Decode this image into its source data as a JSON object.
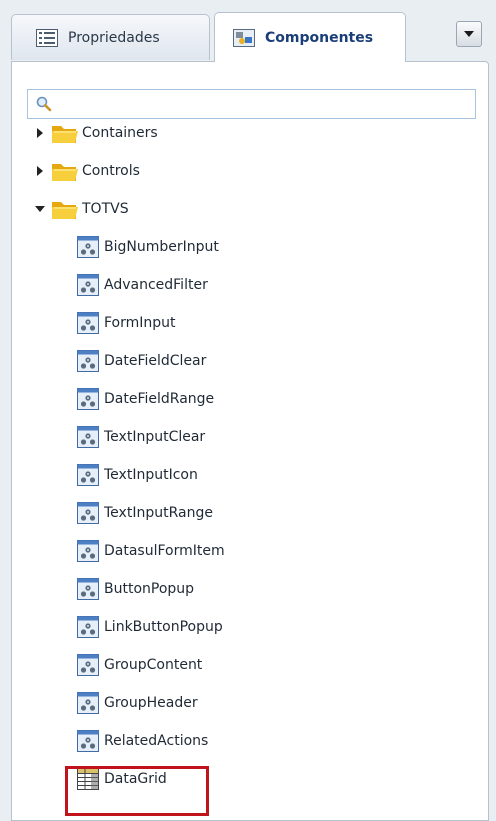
{
  "tabs": {
    "properties": "Propriedades",
    "components": "Componentes"
  },
  "search": {
    "value": "",
    "placeholder": ""
  },
  "tree": {
    "folders": [
      {
        "label": "Containers",
        "expanded": false
      },
      {
        "label": "Controls",
        "expanded": false
      },
      {
        "label": "TOTVS",
        "expanded": true
      }
    ],
    "components": [
      "BigNumberInput",
      "AdvancedFilter",
      "FormInput",
      "DateFieldClear",
      "DateFieldRange",
      "TextInputClear",
      "TextInputIcon",
      "TextInputRange",
      "DatasulFormItem",
      "ButtonPopup",
      "LinkButtonPopup",
      "GroupContent",
      "GroupHeader",
      "RelatedActions",
      "DataGrid"
    ],
    "highlighted": "DataGrid"
  },
  "colors": {
    "accent": "#1a3e78",
    "highlight": "#c0131b",
    "folder": "#f2c21a"
  }
}
